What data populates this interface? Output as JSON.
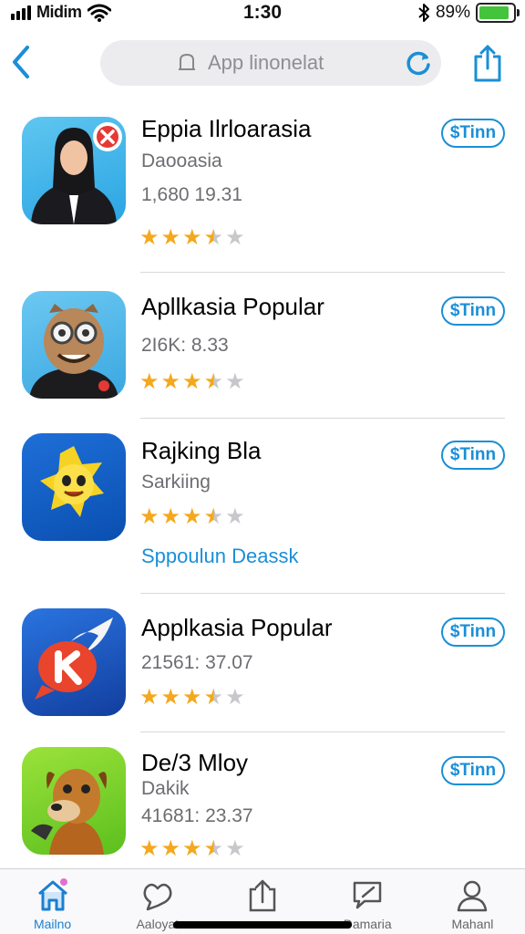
{
  "status_bar": {
    "carrier": "Midim",
    "time": "1:30",
    "battery_percent": "89%",
    "battery_level": 0.89
  },
  "nav": {
    "search_placeholder": "App linonelat",
    "accent_color": "#1a8fd6"
  },
  "apps": [
    {
      "title": "Eppia Ilrloarasia",
      "subtitle": "Daooasia",
      "meta": "1,680 19.31",
      "rating": 3.5,
      "rating_max": 5,
      "price": "$Tinn",
      "icon": "woman-portrait-icon",
      "badge": "close-badge-icon"
    },
    {
      "title": "Apllkasia Popular",
      "subtitle": "",
      "meta": "2I6K: 8.33",
      "rating": 3.5,
      "rating_max": 5,
      "price": "$Tinn",
      "icon": "glasses-character-icon"
    },
    {
      "title": "Rajking Bla",
      "subtitle": "Sarkiing",
      "meta": "",
      "rating": 3.5,
      "rating_max": 5,
      "price": "$Tinn",
      "link": "Sppoulun Deassk",
      "icon": "yellow-star-character-icon"
    },
    {
      "title": "Applkasia Popular",
      "subtitle": "",
      "meta": "21561: 37.07",
      "rating": 3.5,
      "rating_max": 5,
      "price": "$Tinn",
      "icon": "red-k-bubble-icon"
    },
    {
      "title": "De/3 Mloy",
      "subtitle": "Dakik",
      "meta": "41681: 23.37",
      "rating": 3.5,
      "rating_max": 5,
      "price": "$Tinn",
      "icon": "dog-character-icon"
    }
  ],
  "tabs": [
    {
      "label": "Mailno",
      "icon": "home-icon",
      "active": true
    },
    {
      "label": "Aaloyat",
      "icon": "heart-chat-icon",
      "active": false
    },
    {
      "label": "",
      "icon": "share-upload-icon",
      "active": false
    },
    {
      "label": "Damaria",
      "icon": "message-edit-icon",
      "active": false
    },
    {
      "label": "Mahanl",
      "icon": "person-icon",
      "active": false
    }
  ]
}
